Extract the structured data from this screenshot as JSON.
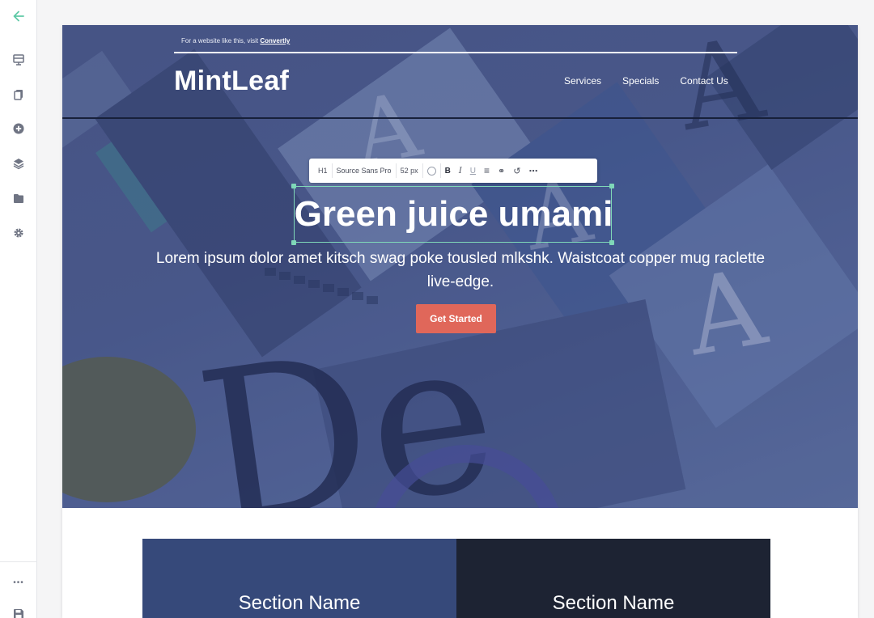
{
  "rail": {
    "icons": [
      "back-arrow-icon",
      "page-layout-icon",
      "copy-pages-icon",
      "add-element-icon",
      "layers-icon",
      "folder-icon",
      "settings-icon",
      "more-icon",
      "save-icon"
    ],
    "more_label": "•••"
  },
  "promo": {
    "text": "For a website like this, visit ",
    "link": "Convertly"
  },
  "header": {
    "logo": "MintLeaf",
    "nav": [
      "Services",
      "Specials",
      "Contact Us"
    ]
  },
  "format_toolbar": {
    "tag": "H1",
    "font": "Source Sans Pro",
    "size": "52 px",
    "bold": "B",
    "italic": "I",
    "underline": "U",
    "align": "≡",
    "link": "⚭",
    "undo": "↺",
    "more": "⋯"
  },
  "hero": {
    "headline": "Green juice umami",
    "subtitle": "Lorem ipsum dolor amet kitsch swag poke tousled mlkshk. Waistcoat copper mug raclette live-edge.",
    "cta": "Get Started"
  },
  "sections": [
    {
      "title": "Section Name"
    },
    {
      "title": "Section Name"
    }
  ],
  "colors": {
    "accent": "#5ec9a6",
    "cta": "#e0675a",
    "hero_tint": "#4a5888",
    "section_left": "#36497a",
    "section_right": "#1d2333"
  }
}
